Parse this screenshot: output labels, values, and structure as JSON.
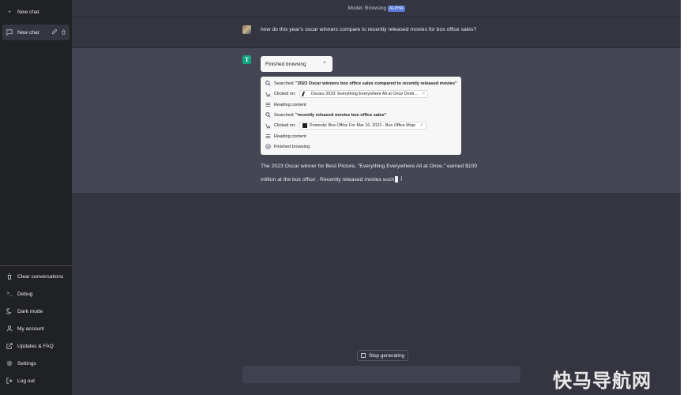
{
  "sidebar": {
    "new_chat_button": "New chat",
    "conversations": [
      {
        "label": "New chat"
      }
    ],
    "bottom_items": [
      {
        "label": "Clear conversations",
        "icon": "trash-icon"
      },
      {
        "label": "Debug",
        "icon": "terminal-icon"
      },
      {
        "label": "Dark mode",
        "icon": "moon-icon"
      },
      {
        "label": "My account",
        "icon": "user-icon"
      },
      {
        "label": "Updates & FAQ",
        "icon": "external-link-icon"
      },
      {
        "label": "Settings",
        "icon": "gear-icon"
      },
      {
        "label": "Log out",
        "icon": "logout-icon"
      }
    ]
  },
  "header": {
    "model_label": "Model: Browsing",
    "badge": "ALPHA"
  },
  "user_message": "how do this year's oscar winners compare to recently released movies for box office sales?",
  "assistant": {
    "avatar_letter": "T",
    "browsing_toggle": "Finished browsing",
    "log": [
      {
        "type": "search",
        "prefix": "Searched:",
        "text": "\"2023 Oscar winners box office sales compared to recently released movies\""
      },
      {
        "type": "click",
        "prefix": "Clicked on:",
        "chip": "Oscars 2023: Everything Everywhere All at Once Domi..."
      },
      {
        "type": "reading",
        "text": "Reading content"
      },
      {
        "type": "search",
        "prefix": "Searched:",
        "text": "\"recently released movies box office sales\""
      },
      {
        "type": "click",
        "prefix": "Clicked on:",
        "chip": "Domestic Box Office For Mar 16, 2023 - Box Office Mojo"
      },
      {
        "type": "reading",
        "text": "Reading content"
      },
      {
        "type": "done",
        "text": "Finished browsing"
      }
    ],
    "answer_line1": "The 2023 Oscar winner for Best Picture, \"Everything Everywhere All at Once,\" earned $100",
    "answer_line2": "million at the box office˙. Recently released movies such"
  },
  "stop_button": "Stop generating",
  "input": {
    "value": "",
    "placeholder": ""
  },
  "watermark": "快马导航网"
}
